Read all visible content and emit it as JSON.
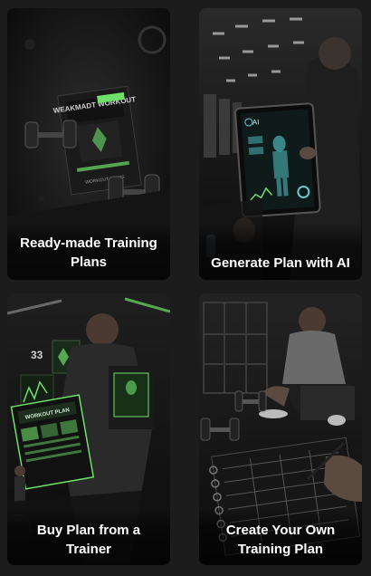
{
  "cards": [
    {
      "label": "Ready-made Training Plans",
      "image": "workout-plan-book-with-dumbbells",
      "book_title": "WEAKMADT WORKOUT",
      "book_subtitle": "WORKOUT PLANS"
    },
    {
      "label": "Generate Plan with AI",
      "image": "tablet-ai-body-scan-in-gym",
      "screen_text": "AI"
    },
    {
      "label": "Buy Plan from a Trainer",
      "image": "trainer-holding-workout-plan",
      "wall_number": "33",
      "book_title": "WORKOUT PLAN"
    },
    {
      "label": "Create Your Own Training Plan",
      "image": "writing-plan-in-notebook"
    }
  ],
  "colors": {
    "accent": "#6ee06a",
    "text": "#ffffff",
    "background": "#1c1c1c"
  }
}
